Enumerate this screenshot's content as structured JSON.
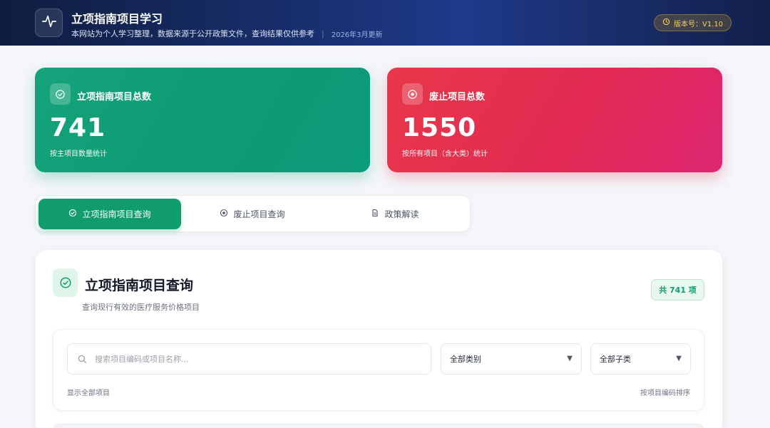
{
  "header": {
    "title": "立项指南项目学习",
    "subtitle": "本网站为个人学习整理，数据来源于公开政策文件，查询结果仅供参考",
    "separator": "|",
    "updated": "2026年3月更新",
    "version": "版本号：V1.10",
    "icons": {
      "logo": "pulse-icon",
      "version": "clock-icon"
    }
  },
  "stats": {
    "approved": {
      "label": "立项指南项目总数",
      "value": "741",
      "caption": "按主项目数量统计",
      "icon": "check-circle-icon",
      "color": "#109c6e"
    },
    "abolished": {
      "label": "废止项目总数",
      "value": "1550",
      "caption": "按所有项目（含大类）统计",
      "icon": "target-circle-icon",
      "color": "#e22a53"
    }
  },
  "tabs": [
    {
      "label": "立项指南项目查询",
      "icon": "check-circle-icon",
      "active": true
    },
    {
      "label": "废止项目查询",
      "icon": "target-circle-icon",
      "active": false
    },
    {
      "label": "政策解读",
      "icon": "document-icon",
      "active": false
    }
  ],
  "panel": {
    "title": "立项指南项目查询",
    "subtitle": "查询现行有效的医疗服务价格项目",
    "count_badge": "共 741 项",
    "search": {
      "placeholder": "搜索项目编码或项目名称...",
      "value": ""
    },
    "category_select": {
      "selected": "全部类别"
    },
    "subcategory_select": {
      "selected": "全部子类"
    },
    "status_text": "显示全部项目",
    "sort_text": "按项目编码排序"
  }
}
